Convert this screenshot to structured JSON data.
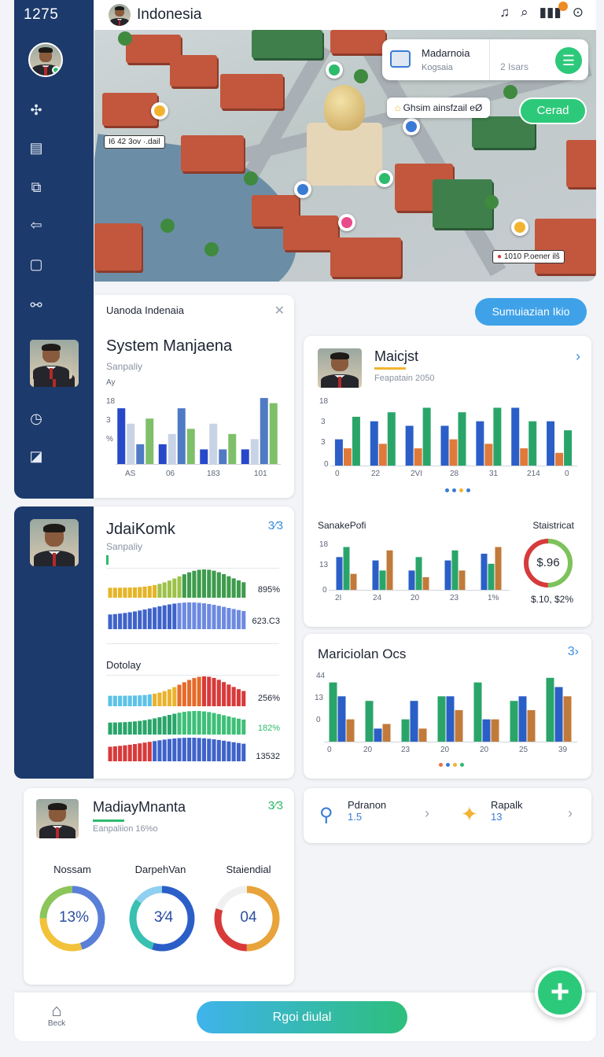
{
  "status": {
    "time": "1275"
  },
  "header": {
    "title": "Indonesia"
  },
  "map": {
    "card": {
      "title": "Madarnoia",
      "subtitle": "Kogsaia",
      "extra": "2 Isars"
    },
    "chip_main": "Ghsim ainsfzail",
    "chip_main_suffix": "eØ",
    "cerad_label": "Cerad",
    "label_left": "42 3ov ·.dail",
    "label_left_prefix": "I6",
    "label_right": "1010 P.oener  ilŝ"
  },
  "panel1": {
    "header": "Uanoda Indenaia",
    "title": "System Manjaena",
    "sub": "Sanpaliy",
    "axis_top": "Ay",
    "yticks": [
      "18",
      "3",
      "%"
    ],
    "xticks": [
      "AS",
      "06",
      "183",
      "101"
    ]
  },
  "simulate_btn": "Sumuiazian Ikio",
  "panel2": {
    "title": "Maicjst",
    "sub": "Feapatain 2050",
    "yticks": [
      "18",
      "3",
      "3",
      "0"
    ],
    "xticks": [
      "0",
      "22",
      "2VI",
      "28",
      "31",
      "214",
      "0"
    ],
    "section_left": "SanakePofi",
    "section_right": "Staistricat",
    "yticks2": [
      "18",
      "13",
      "0"
    ],
    "xticks2": [
      "2I",
      "24",
      "20",
      "23",
      "1%"
    ],
    "gauge_value": "$.96",
    "gauge_caption": "$.10, $2%"
  },
  "panel3": {
    "title": "JdaiKomk",
    "sub": "Sanpaliy",
    "badge": "3⁄3",
    "row1_value": "895%",
    "row2_value": "623.C3",
    "section": "Dotolay",
    "row3_value": "256%",
    "row4_value": "182%",
    "row5_value": "13532"
  },
  "panel4": {
    "title": "Mariciolan Ocs",
    "yticks": [
      "44",
      "13",
      "0"
    ],
    "xticks": [
      "0",
      "20",
      "23",
      "20",
      "20",
      "25",
      "39"
    ]
  },
  "panel5": {
    "title": "MadiayMnanta",
    "sub": "Eanpaliion 16%o",
    "badge": "3⁄3",
    "donuts": [
      {
        "label": "Nossam",
        "value": "13%"
      },
      {
        "label": "DarpehVan",
        "value": "3⁄4"
      },
      {
        "label": "Staiendial",
        "value": "04"
      }
    ]
  },
  "mini_nav": {
    "item1_label": "Pdranon",
    "item1_value": "1.5",
    "item2_label": "Rapalk",
    "item2_value": "13"
  },
  "bottom": {
    "back_label": "Beck",
    "primary_label": "Rgoi diulal"
  },
  "colors": {
    "navy": "#1c3a6b",
    "green": "#2dc97a",
    "blue": "#3fa2e8"
  },
  "chart_data": [
    {
      "type": "bar",
      "title": "System Manjaena",
      "categories": [
        "AS",
        "06",
        "183",
        "101"
      ],
      "series": [
        {
          "values": [
            11,
            4,
            3,
            3
          ]
        },
        {
          "values": [
            8,
            6,
            8,
            5
          ]
        },
        {
          "values": [
            4,
            11,
            3,
            13
          ]
        },
        {
          "values": [
            9,
            7,
            6,
            12
          ]
        }
      ],
      "ylim": [
        0,
        15
      ]
    },
    {
      "type": "bar",
      "title": "Maicjst",
      "categories": [
        "0",
        "22",
        "2VI",
        "28",
        "31",
        "214",
        "0"
      ],
      "series": [
        {
          "values": [
            6,
            10,
            9,
            9,
            10,
            13,
            10
          ]
        },
        {
          "values": [
            4,
            5,
            4,
            6,
            5,
            4,
            3
          ]
        },
        {
          "values": [
            11,
            12,
            13,
            12,
            13,
            10,
            8
          ]
        }
      ],
      "ylim": [
        0,
        15
      ]
    },
    {
      "type": "bar",
      "title": "Mariciolan Ocs",
      "categories": [
        "0",
        "20",
        "23",
        "20",
        "20",
        "25",
        "39"
      ],
      "series": [
        {
          "values": [
            13,
            9,
            5,
            10,
            13,
            9,
            14
          ]
        },
        {
          "values": [
            10,
            3,
            9,
            10,
            5,
            10,
            12
          ]
        },
        {
          "values": [
            5,
            4,
            3,
            7,
            5,
            7,
            10
          ]
        }
      ],
      "ylim": [
        0,
        15
      ]
    },
    {
      "type": "pie",
      "title": "MadiayMnanta",
      "series": [
        {
          "name": "Nossam",
          "values": [
            13
          ]
        },
        {
          "name": "DarpehVan",
          "values": [
            75
          ]
        },
        {
          "name": "Staiendial",
          "values": [
            60
          ]
        }
      ]
    }
  ]
}
